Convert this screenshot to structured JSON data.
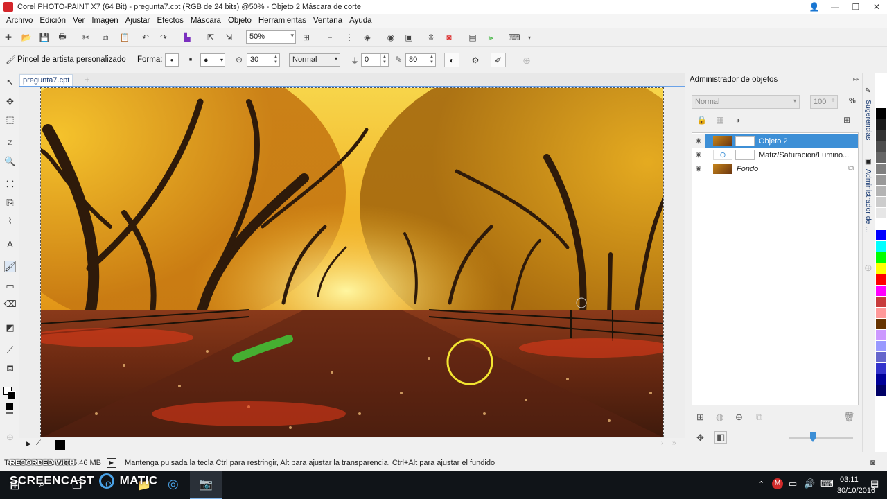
{
  "window": {
    "title": "Corel PHOTO-PAINT X7 (64 Bit) - pregunta7.cpt (RGB de 24 bits) @50% - Objeto 2 Máscara de corte",
    "controls": [
      "minimize-icon",
      "restore-icon",
      "close-icon"
    ]
  },
  "menu": [
    "Archivo",
    "Edición",
    "Ver",
    "Imagen",
    "Ajustar",
    "Efectos",
    "Máscara",
    "Objeto",
    "Herramientas",
    "Ventana",
    "Ayuda"
  ],
  "toolbar": {
    "zoom": "50%"
  },
  "propbar": {
    "tool_name": "Pincel de artista personalizado",
    "forma_label": "Forma:",
    "size": "30",
    "merge_mode": "Normal",
    "transparency": "0",
    "opacity_pct": "80"
  },
  "document": {
    "tab": "pregunta7.cpt"
  },
  "objects_manager": {
    "title": "Administrador de objetos",
    "blend_mode": "Normal",
    "opacity": "100",
    "opacity_unit": "%",
    "layers": [
      {
        "name": "Objeto 2",
        "selected": true
      },
      {
        "name": "Matiz/Saturación/Lumino...",
        "selected": false
      },
      {
        "name": "Fondo",
        "selected": false
      }
    ]
  },
  "side_tabs": {
    "tab1": "Sugerencias",
    "tab2": "Administrador de ..."
  },
  "palette_colors": [
    "#000000",
    "#1a1a1a",
    "#333333",
    "#4d4d4d",
    "#666666",
    "#808080",
    "#999999",
    "#b3b3b3",
    "#cccccc",
    "#e6e6e6",
    "#ffffff",
    "#0000ff",
    "#00ffff",
    "#00ff00",
    "#ffff00",
    "#ff0000",
    "#ff00ff",
    "#c83c3c",
    "#ff9999",
    "#663300",
    "#cc99ff",
    "#9999ff",
    "#6666cc",
    "#3333cc",
    "#000099",
    "#000066"
  ],
  "status": {
    "file_size_label": "Tamaño de archivo: 5.46 MB",
    "hint": "Mantenga pulsada la tecla Ctrl para restringir, Alt para ajustar la transparencia, Ctrl+Alt para ajustar el fundido"
  },
  "watermark": {
    "line1": "RECORDED WITH",
    "line2": "SCREENCAST",
    "line3": "MATIC"
  },
  "taskbar": {
    "time": "03:11",
    "date": "30/10/2016"
  }
}
